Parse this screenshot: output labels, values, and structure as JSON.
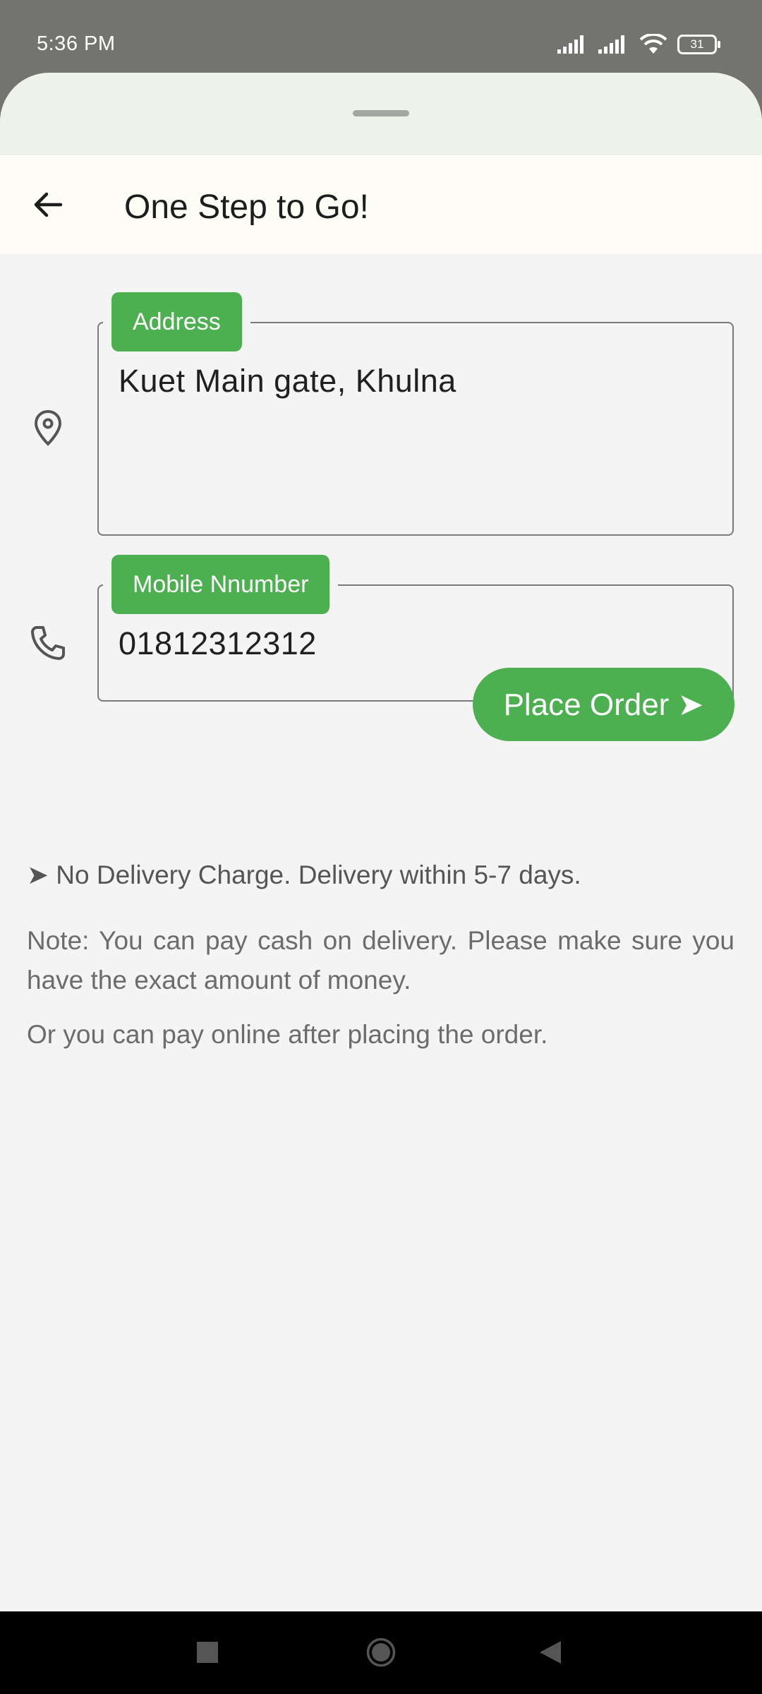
{
  "status_bar": {
    "time": "5:36 PM",
    "battery": "31",
    "icons": [
      "signal-icon",
      "signal-icon",
      "wifi-icon",
      "battery-icon"
    ]
  },
  "app_bar": {
    "title": "One Step to Go!",
    "back_icon": "arrow-left-icon"
  },
  "form": {
    "address": {
      "label": "Address",
      "value": "Kuet Main gate, Khulna",
      "icon": "location-pin-icon"
    },
    "mobile": {
      "label": "Mobile Nnumber",
      "value": "01812312312",
      "icon": "phone-icon"
    },
    "submit_label": "Place Order ➤"
  },
  "info": {
    "delivery": "➤ No Delivery Charge. Delivery within 5-7 days.",
    "note": "Note: You can pay cash on delivery. Please make sure you have the exact amount of money.",
    "online": "Or you can pay online after placing the order."
  },
  "colors": {
    "accent": "#4caf50",
    "app_bar_bg": "#fdfdf5",
    "page_bg": "#f4f4f4",
    "status_bar_bg": "#737470"
  },
  "nav_bar": {
    "icons": [
      "recents-square-icon",
      "home-circle-icon",
      "back-triangle-icon"
    ]
  }
}
